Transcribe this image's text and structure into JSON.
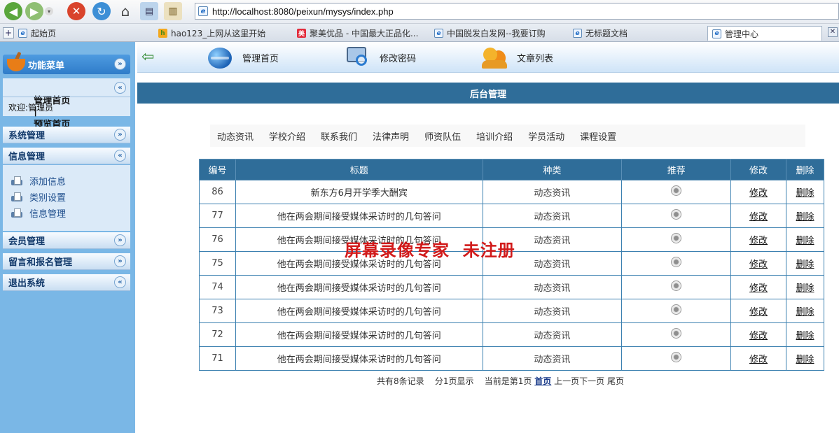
{
  "browser": {
    "address": "http://localhost:8080/peixun/mysys/index.php",
    "tabs": [
      {
        "label": "起始页",
        "icon": "ie-icon"
      },
      {
        "label": "hao123_上网从这里开始",
        "icon": "hao123-icon"
      },
      {
        "label": "聚美优品 - 中国最大正品化...",
        "icon": "jumei-icon"
      },
      {
        "label": "中国脱发白发网--我要订购",
        "icon": "ie-icon"
      },
      {
        "label": "无标题文档",
        "icon": "ie-icon"
      },
      {
        "label": "管理中心",
        "icon": "ie-icon",
        "active": true
      }
    ]
  },
  "sidebar": {
    "title": "功能菜单",
    "links": {
      "home": "管理首页",
      "sep": "|",
      "preview": "预览首页"
    },
    "welcome": "欢迎:管理员",
    "sections": [
      {
        "label": "系统管理",
        "state": "collapsed"
      },
      {
        "label": "信息管理",
        "state": "expanded",
        "items": [
          "添加信息",
          "类别设置",
          "信息管理"
        ]
      },
      {
        "label": "会员管理",
        "state": "collapsed"
      },
      {
        "label": "留言和报名管理",
        "state": "collapsed"
      },
      {
        "label": "退出系统",
        "state": "exit"
      }
    ]
  },
  "topnav": {
    "items": [
      {
        "label": "管理首页",
        "icon": "globe-icon"
      },
      {
        "label": "修改密码",
        "icon": "password-icon"
      },
      {
        "label": "文章列表",
        "icon": "users-icon"
      }
    ]
  },
  "banner": "后台管理",
  "categories": [
    "动态资讯",
    "学校介绍",
    "联系我们",
    "法律声明",
    "师资队伍",
    "培训介绍",
    "学员活动",
    "课程设置"
  ],
  "table": {
    "headers": [
      "编号",
      "标题",
      "种类",
      "推荐",
      "修改",
      "删除"
    ],
    "rows": [
      {
        "id": "86",
        "title": "新东方6月开学季大酬宾",
        "type": "动态资讯",
        "edit": "修改",
        "del": "删除"
      },
      {
        "id": "77",
        "title": "他在两会期间接受媒体采访时的几句答问",
        "type": "动态资讯",
        "edit": "修改",
        "del": "删除"
      },
      {
        "id": "76",
        "title": "他在两会期间接受媒体采访时的几句答问",
        "type": "动态资讯",
        "edit": "修改",
        "del": "删除"
      },
      {
        "id": "75",
        "title": "他在两会期间接受媒体采访时的几句答问",
        "type": "动态资讯",
        "edit": "修改",
        "del": "删除"
      },
      {
        "id": "74",
        "title": "他在两会期间接受媒体采访时的几句答问",
        "type": "动态资讯",
        "edit": "修改",
        "del": "删除"
      },
      {
        "id": "73",
        "title": "他在两会期间接受媒体采访时的几句答问",
        "type": "动态资讯",
        "edit": "修改",
        "del": "删除"
      },
      {
        "id": "72",
        "title": "他在两会期间接受媒体采访时的几句答问",
        "type": "动态资讯",
        "edit": "修改",
        "del": "删除"
      },
      {
        "id": "71",
        "title": "他在两会期间接受媒体采访时的几句答问",
        "type": "动态资讯",
        "edit": "修改",
        "del": "删除"
      }
    ]
  },
  "pager": {
    "summary": "共有8条记录    分1页显示    当前是第1页 ",
    "first": "首页",
    "prev": "上一页",
    "next": "下一页",
    "last": "尾页"
  },
  "watermark": "屏幕录像专家  未注册"
}
